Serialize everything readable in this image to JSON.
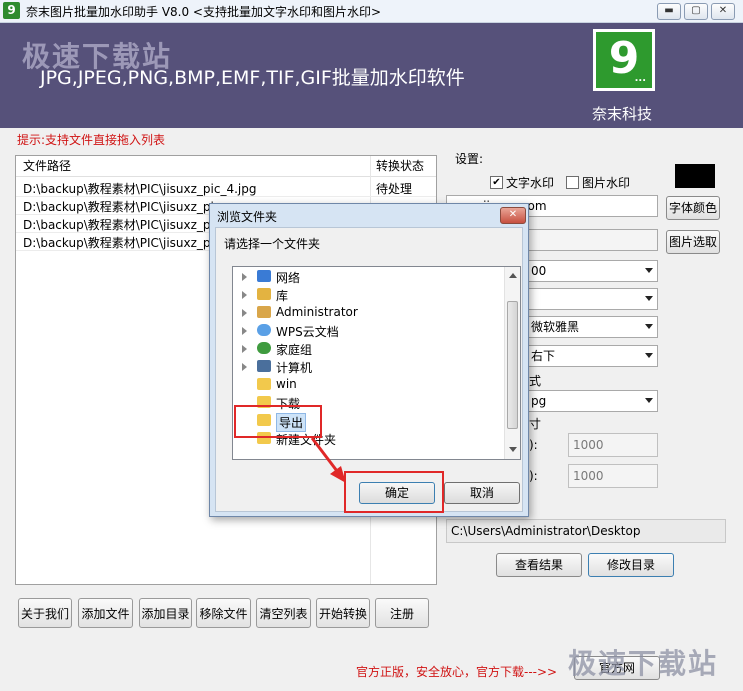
{
  "window": {
    "title": "奈末图片批量加水印助手 V8.0    <支持批量加文字水印和图片水印>",
    "app_icon": "9"
  },
  "banner": {
    "watermark": "极速下载站",
    "formats": "JPG,JPEG,PNG,BMP,EMF,TIF,GIF批量加水印软件",
    "logo": "9",
    "logo_dots": "...",
    "company": "奈末科技"
  },
  "hint": "提示:支持文件直接拖入列表",
  "file_table": {
    "headers": [
      "文件路径",
      "转换状态"
    ],
    "rows": [
      {
        "path": "D:\\backup\\教程素材\\PIC\\jisuxz_pic_4.jpg",
        "status": "待处理"
      },
      {
        "path": "D:\\backup\\教程素材\\PIC\\jisuxz_pic",
        "status": ""
      },
      {
        "path": "D:\\backup\\教程素材\\PIC\\jisuxz_pic",
        "status": ""
      },
      {
        "path": "D:\\backup\\教程素材\\PIC\\jisuxz_pic",
        "status": ""
      }
    ]
  },
  "buttons": {
    "about": "关于我们",
    "add_file": "添加文件",
    "add_dir": "添加目录",
    "remove_file": "移除文件",
    "clear_list": "清空列表",
    "start": "开始转换",
    "register": "注册",
    "view_result": "查看结果",
    "change_dir": "修改目录",
    "official_site": "官方网"
  },
  "settings": {
    "label": "设置:",
    "text_watermark_label": "文字水印",
    "text_watermark_checked": true,
    "image_watermark_label": "图片水印",
    "image_watermark_checked": false,
    "text_value": "www.jisuxz.com",
    "font_color_button": "字体颜色",
    "font_color": "#000000",
    "image_pick_button": "图片选取",
    "dropdown_1": "00",
    "dropdown_2": "",
    "dropdown_3": "微软雅黑",
    "dropdown_4": "右下",
    "format_label_fragment": "式",
    "dropdown_5": "pg",
    "size_label_fragment": "寸",
    "width_colon": "):",
    "height_colon": "):",
    "width_value": "1000",
    "height_value": "1000",
    "output_dir": "C:\\Users\\Administrator\\Desktop"
  },
  "footer": {
    "text": "官方正版，安全放心，官方下载--->>",
    "watermark": "极速下载站"
  },
  "dialog": {
    "title": "浏览文件夹",
    "prompt": "请选择一个文件夹",
    "tree": [
      {
        "label": "网络",
        "icon": "network-icon",
        "expandable": true
      },
      {
        "label": "库",
        "icon": "library-icon",
        "expandable": true
      },
      {
        "label": "Administrator",
        "icon": "user-folder-icon",
        "expandable": true
      },
      {
        "label": "WPS云文档",
        "icon": "cloud-docs-icon",
        "expandable": true
      },
      {
        "label": "家庭组",
        "icon": "homegroup-icon",
        "expandable": true
      },
      {
        "label": "计算机",
        "icon": "computer-icon",
        "expandable": true
      },
      {
        "label": "win",
        "icon": "folder-icon",
        "expandable": false
      },
      {
        "label": "下载",
        "icon": "folder-icon",
        "expandable": false
      },
      {
        "label": "导出",
        "icon": "folder-icon",
        "expandable": false,
        "selected": true
      },
      {
        "label": "新建文件夹",
        "icon": "folder-icon",
        "expandable": false
      }
    ],
    "ok": "确定",
    "cancel": "取消"
  },
  "colors": {
    "banner": "#56517a",
    "hint_red": "#d01414",
    "annotation_red": "#e02828",
    "logo_green": "#2e9a2e"
  }
}
